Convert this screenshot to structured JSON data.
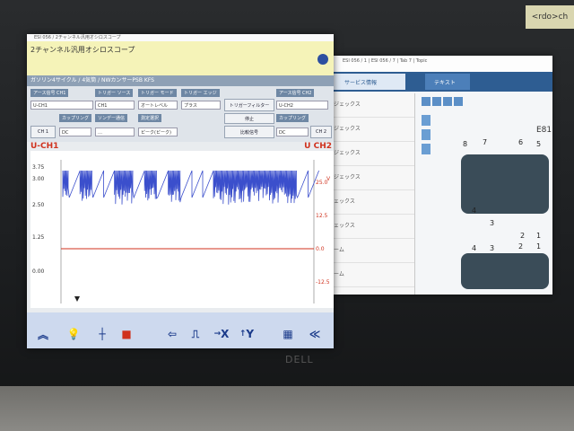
{
  "sticky_note": "<rdo>ch",
  "brand": "DELL",
  "right_window": {
    "title": "ESI 056 / 1 | ESI 056 / 7 | Tab 7 | Topic",
    "tab1": "サービス情報",
    "tab2": "テキスト",
    "left_items": [
      "ジェックス",
      "ジェックス",
      "ジェックス",
      "ジェックス",
      "ェックス",
      "ェックス",
      "ーム",
      "ーム"
    ],
    "connector_label": "E81",
    "pins_top": [
      "8",
      "7",
      "6",
      "5"
    ],
    "pins_mid": [
      "4",
      "3",
      "2",
      "1"
    ],
    "pins_bottom": [
      "4",
      "3",
      "2",
      "1"
    ]
  },
  "scope": {
    "window_title": "ESI 056 / 2チャンネル汎用オシロスコープ",
    "banner_title": "2チャンネル汎用オシロスコープ",
    "header": "ガソリン4サイクル / 4気筒 / NWカンサーPSB KFS",
    "labels": {
      "ch1_signal": "アース信号 CH1",
      "trigger_source": "トリガー ソース",
      "trigger_mode": "トリガー モード",
      "trigger_edge": "トリガー エッジ",
      "ch2_signal": "アース信号 CH2",
      "coupling1": "カップリング",
      "sync": "ソンデー通信",
      "measure": "測定選択",
      "coupling2": "カップリング"
    },
    "values": {
      "ch1_select": "U-CH1",
      "trig_src": "CH1",
      "trig_mode": "オートレベル",
      "trig_edge": "プラス",
      "ch2_select": "U-CH2",
      "coup1": "DC",
      "sync_val": "…",
      "measure_val": "ピーク(ピーク)",
      "coup2": "DC"
    },
    "buttons": {
      "ch1": "CH 1",
      "ch2": "CH 2",
      "trigger_filter": "トリガーフィルター",
      "pause": "停止",
      "compare": "比較信号"
    },
    "channel_labels": {
      "left": "U-CH1",
      "right": "U CH2"
    },
    "left_ticks": [
      "3.75",
      "3.00",
      "2.50",
      "1.25",
      "0.00"
    ],
    "right_ticks": [
      "25.0",
      "12.5",
      "0.0",
      "-12.5"
    ],
    "right_unit": "V",
    "toolbar": {
      "x": "X",
      "y": "Y"
    },
    "colors": {
      "ch1": "#3b4fcc",
      "ch2": "#d0321e"
    }
  }
}
